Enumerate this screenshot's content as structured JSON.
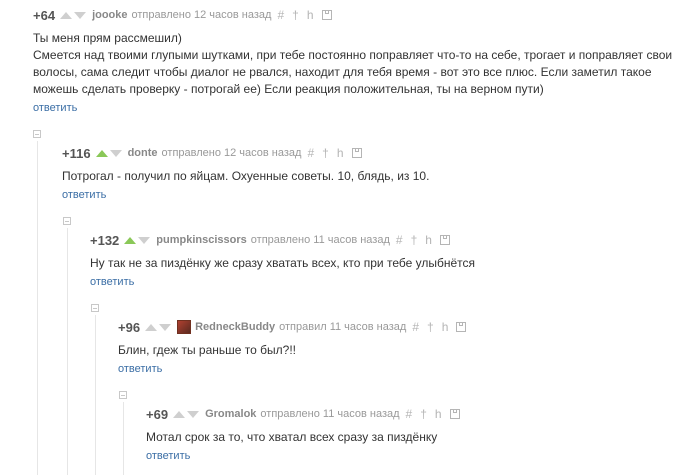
{
  "comments": [
    {
      "rating": "+64",
      "author": "joooke",
      "meta": "отправлено 12 часов назад",
      "up_active": false,
      "text": "Ты меня прям рассмешил)\nСмеется над твоими глупыми шутками, при тебе постоянно поправляет что-то на себе, трогает и поправляет свои волосы, сама следит чтобы диалог не рвался, находит для тебя время - вот это все плюс. Если заметил такое можешь сделать проверку - потрогай ее) Если реакция положительная, ты на верном пути)",
      "reply": "ответить"
    },
    {
      "rating": "+116",
      "author": "donte",
      "meta": "отправлено 12 часов назад",
      "up_active": true,
      "text": "Потрогал - получил по яйцам. Охуенные советы. 10, блядь, из 10.",
      "reply": "ответить"
    },
    {
      "rating": "+132",
      "author": "pumpkinscissors",
      "meta": "отправлено 11 часов назад",
      "up_active": true,
      "text": "Ну так не за пиздёнку же сразу хватать всех, кто при тебе улыбнётся",
      "reply": "ответить"
    },
    {
      "rating": "+96",
      "author": "RedneckBuddy",
      "meta": "отправил 11 часов назад",
      "up_active": false,
      "has_avatar": true,
      "text": "Блин, гдеж ты раньше то был?!!",
      "reply": "ответить"
    },
    {
      "rating": "+69",
      "author": "Gromalok",
      "meta": "отправлено 11 часов назад",
      "up_active": false,
      "text": "Мотал срок за то, что хватал всех сразу за пиздёнку",
      "reply": "ответить"
    }
  ],
  "icons": [
    "hash-icon",
    "pin-icon",
    "branch-icon",
    "save-icon"
  ],
  "colors": {
    "link": "#3b6ea5",
    "upvote_active": "#8ac858",
    "arrow_inactive": "#cfcfcf"
  }
}
